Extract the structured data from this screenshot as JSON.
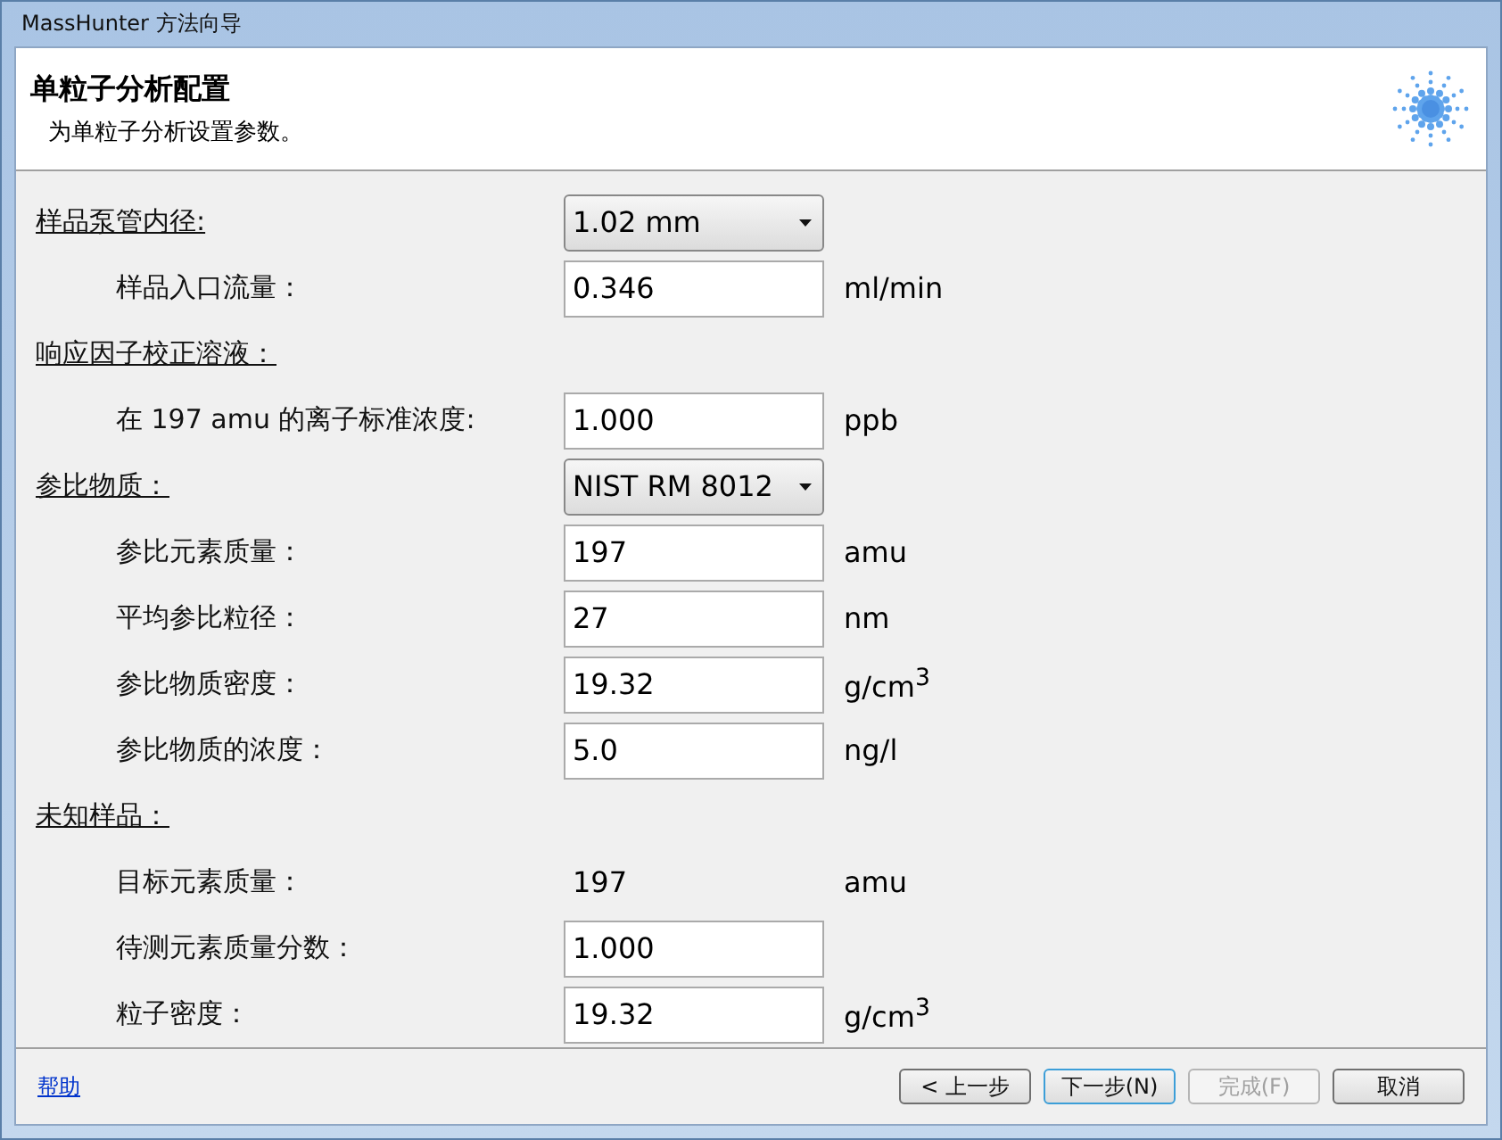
{
  "window": {
    "title": "MassHunter 方法向导"
  },
  "header": {
    "title": "单粒子分析配置",
    "subtitle": "为单粒子分析设置参数。"
  },
  "rows": [
    {
      "kind": "dropdown",
      "heading": true,
      "label": "样品泵管内径:",
      "value": "1.02 mm"
    },
    {
      "kind": "input",
      "heading": false,
      "label": "样品入口流量：",
      "value": "0.346",
      "unit": "ml/min"
    },
    {
      "kind": "section",
      "heading": true,
      "label": "响应因子校正溶液："
    },
    {
      "kind": "input",
      "heading": false,
      "label": "在 197 amu 的离子标准浓度:",
      "value": "1.000",
      "unit": "ppb"
    },
    {
      "kind": "dropdown",
      "heading": true,
      "label": "参比物质：",
      "value": "NIST RM 8012"
    },
    {
      "kind": "input",
      "heading": false,
      "label": "参比元素质量：",
      "value": "197",
      "unit": "amu"
    },
    {
      "kind": "input",
      "heading": false,
      "label": "平均参比粒径：",
      "value": "27",
      "unit": "nm"
    },
    {
      "kind": "input",
      "heading": false,
      "label": "参比物质密度：",
      "value": "19.32",
      "unit": "g/cm$^{3}$"
    },
    {
      "kind": "input",
      "heading": false,
      "label": "参比物质的浓度：",
      "value": "5.0",
      "unit": "ng/l"
    },
    {
      "kind": "section",
      "heading": true,
      "label": "未知样品："
    },
    {
      "kind": "static",
      "heading": false,
      "label": "目标元素质量：",
      "value": "197",
      "unit": "amu"
    },
    {
      "kind": "input",
      "heading": false,
      "label": "待测元素质量分数：",
      "value": "1.000"
    },
    {
      "kind": "input",
      "heading": false,
      "label": "粒子密度：",
      "value": "19.32",
      "unit": "g/cm$^{3}$"
    }
  ],
  "footer": {
    "help": "帮助",
    "buttons": [
      {
        "label": "< 上一步",
        "disabled": false,
        "default": false
      },
      {
        "label": "下一步(N)",
        "disabled": false,
        "default": true
      },
      {
        "label": "完成(F)",
        "disabled": true,
        "default": false
      },
      {
        "label": "取消",
        "disabled": false,
        "default": false
      }
    ]
  }
}
